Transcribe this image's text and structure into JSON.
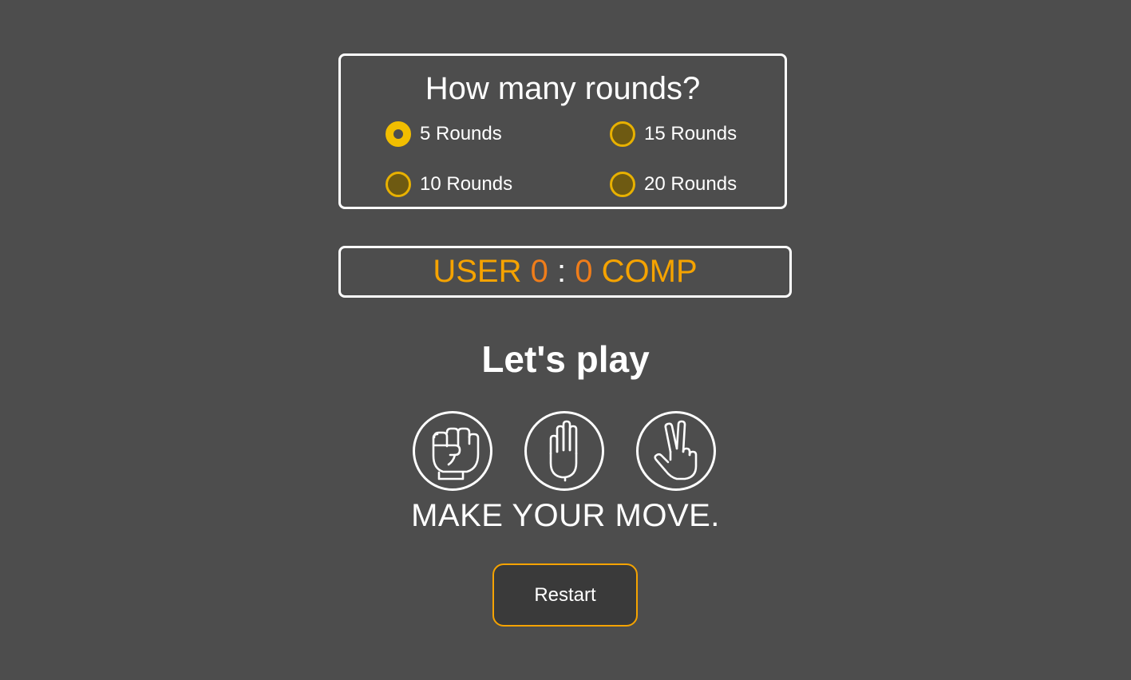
{
  "rounds": {
    "title": "How many rounds?",
    "options": [
      {
        "label": "5 Rounds",
        "checked": true
      },
      {
        "label": "15 Rounds",
        "checked": false
      },
      {
        "label": "10 Rounds",
        "checked": false
      },
      {
        "label": "20 Rounds",
        "checked": false
      }
    ]
  },
  "score": {
    "user_label": "USER",
    "user_score": "0",
    "separator": ":",
    "comp_score": "0",
    "comp_label": "COMP"
  },
  "status": {
    "heading": "Let's play",
    "prompt": "MAKE YOUR MOVE."
  },
  "moves": [
    {
      "icon": "rock-fist-icon"
    },
    {
      "icon": "paper-hand-icon"
    },
    {
      "icon": "scissors-hand-icon"
    }
  ],
  "controls": {
    "restart_label": "Restart"
  },
  "colors": {
    "background": "#4d4d4d",
    "accent": "#f5a300",
    "score_number": "#f07d1a",
    "radio": "#f2be00"
  }
}
